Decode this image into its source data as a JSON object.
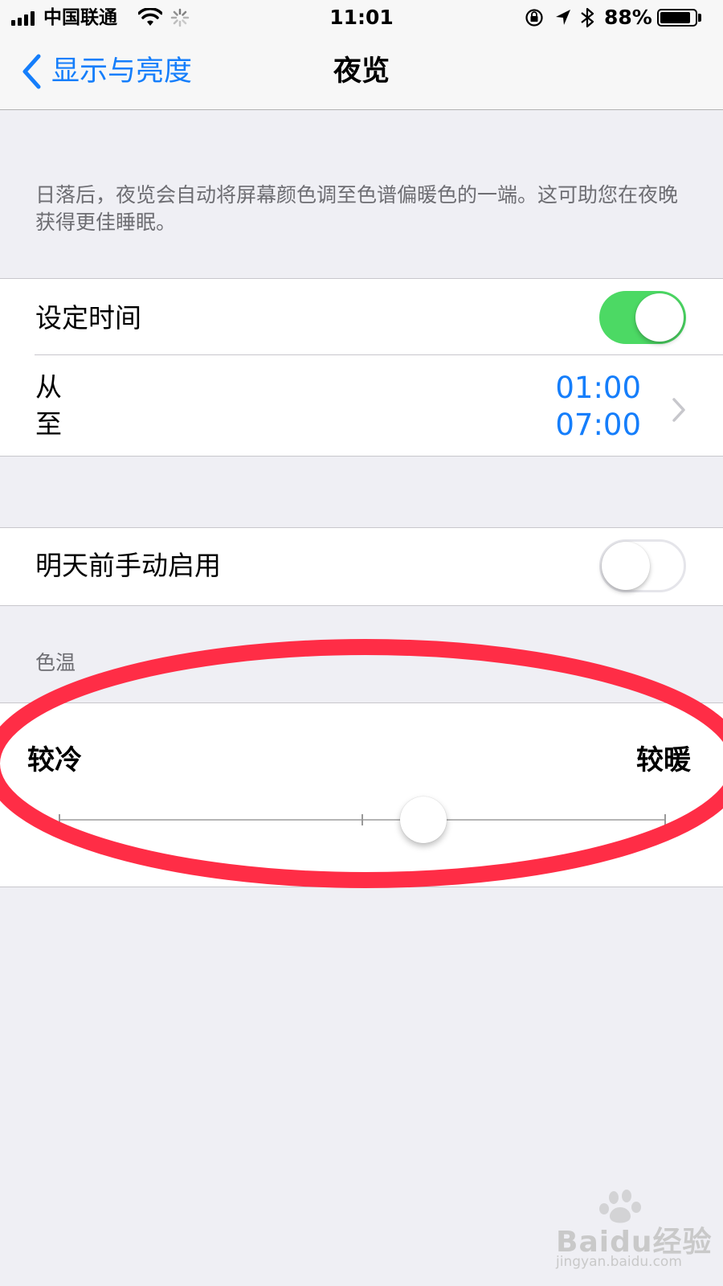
{
  "status_bar": {
    "carrier": "中国联通",
    "time": "11:01",
    "battery": "88%",
    "battery_level": 0.88,
    "icons": [
      "signal-icon",
      "wifi-icon",
      "loading-icon",
      "orientation-lock-icon",
      "location-icon",
      "bluetooth-icon",
      "battery-icon"
    ]
  },
  "nav": {
    "back_label": "显示与亮度",
    "title": "夜览"
  },
  "description": "日落后，夜览会自动将屏幕颜色调至色谱偏暖色的一端。这可助您在夜晚获得更佳睡眠。",
  "schedule": {
    "label": "设定时间",
    "enabled": true,
    "from_label": "从",
    "to_label": "至",
    "from_time": "01:00",
    "to_time": "07:00"
  },
  "manual": {
    "label": "明天前手动启用",
    "enabled": false
  },
  "color_temp": {
    "header": "色温",
    "left_label": "较冷",
    "right_label": "较暖",
    "value": 0.6
  },
  "colors": {
    "accent": "#157efb",
    "toggle_on": "#4cd964",
    "highlight": "#ff2d46"
  },
  "watermark": {
    "text": "Baidu经验",
    "url": "jingyan.baidu.com"
  }
}
